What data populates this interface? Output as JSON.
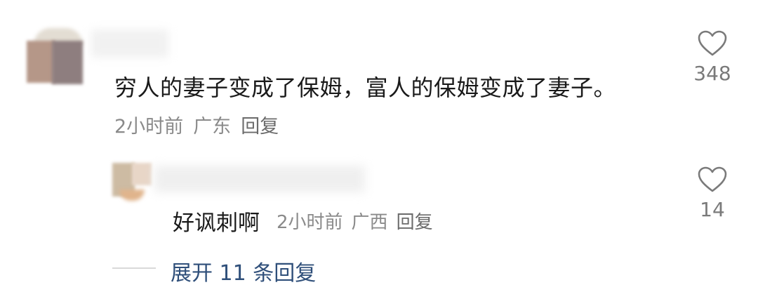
{
  "comment": {
    "text": "穷人的妻子变成了保姆，富人的保姆变成了妻子。",
    "time": "2小时前",
    "location": "广东",
    "reply_label": "回复",
    "like_count": "348"
  },
  "reply": {
    "text": "好讽刺啊",
    "time": "2小时前",
    "location": "广西",
    "reply_label": "回复",
    "like_count": "14"
  },
  "expand": {
    "label": "展开 11 条回复"
  },
  "colors": {
    "text": "#1a1a1a",
    "meta": "#8a8a8a",
    "link": "#2f4f7a",
    "heart": "#7a7a7a"
  },
  "icons": {
    "like": "heart-outline-icon"
  }
}
